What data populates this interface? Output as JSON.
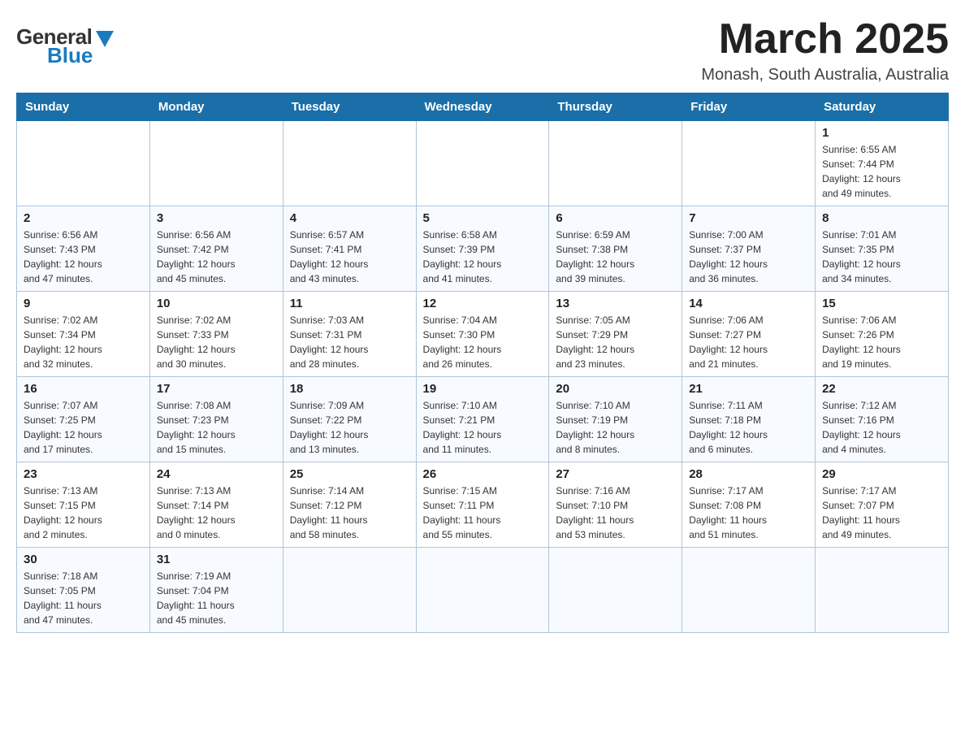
{
  "logo": {
    "general": "General",
    "blue": "Blue",
    "triangle": "▲"
  },
  "title": {
    "month": "March 2025",
    "location": "Monash, South Australia, Australia"
  },
  "weekdays": [
    "Sunday",
    "Monday",
    "Tuesday",
    "Wednesday",
    "Thursday",
    "Friday",
    "Saturday"
  ],
  "weeks": [
    [
      {
        "day": "",
        "info": ""
      },
      {
        "day": "",
        "info": ""
      },
      {
        "day": "",
        "info": ""
      },
      {
        "day": "",
        "info": ""
      },
      {
        "day": "",
        "info": ""
      },
      {
        "day": "",
        "info": ""
      },
      {
        "day": "1",
        "info": "Sunrise: 6:55 AM\nSunset: 7:44 PM\nDaylight: 12 hours\nand 49 minutes."
      }
    ],
    [
      {
        "day": "2",
        "info": "Sunrise: 6:56 AM\nSunset: 7:43 PM\nDaylight: 12 hours\nand 47 minutes."
      },
      {
        "day": "3",
        "info": "Sunrise: 6:56 AM\nSunset: 7:42 PM\nDaylight: 12 hours\nand 45 minutes."
      },
      {
        "day": "4",
        "info": "Sunrise: 6:57 AM\nSunset: 7:41 PM\nDaylight: 12 hours\nand 43 minutes."
      },
      {
        "day": "5",
        "info": "Sunrise: 6:58 AM\nSunset: 7:39 PM\nDaylight: 12 hours\nand 41 minutes."
      },
      {
        "day": "6",
        "info": "Sunrise: 6:59 AM\nSunset: 7:38 PM\nDaylight: 12 hours\nand 39 minutes."
      },
      {
        "day": "7",
        "info": "Sunrise: 7:00 AM\nSunset: 7:37 PM\nDaylight: 12 hours\nand 36 minutes."
      },
      {
        "day": "8",
        "info": "Sunrise: 7:01 AM\nSunset: 7:35 PM\nDaylight: 12 hours\nand 34 minutes."
      }
    ],
    [
      {
        "day": "9",
        "info": "Sunrise: 7:02 AM\nSunset: 7:34 PM\nDaylight: 12 hours\nand 32 minutes."
      },
      {
        "day": "10",
        "info": "Sunrise: 7:02 AM\nSunset: 7:33 PM\nDaylight: 12 hours\nand 30 minutes."
      },
      {
        "day": "11",
        "info": "Sunrise: 7:03 AM\nSunset: 7:31 PM\nDaylight: 12 hours\nand 28 minutes."
      },
      {
        "day": "12",
        "info": "Sunrise: 7:04 AM\nSunset: 7:30 PM\nDaylight: 12 hours\nand 26 minutes."
      },
      {
        "day": "13",
        "info": "Sunrise: 7:05 AM\nSunset: 7:29 PM\nDaylight: 12 hours\nand 23 minutes."
      },
      {
        "day": "14",
        "info": "Sunrise: 7:06 AM\nSunset: 7:27 PM\nDaylight: 12 hours\nand 21 minutes."
      },
      {
        "day": "15",
        "info": "Sunrise: 7:06 AM\nSunset: 7:26 PM\nDaylight: 12 hours\nand 19 minutes."
      }
    ],
    [
      {
        "day": "16",
        "info": "Sunrise: 7:07 AM\nSunset: 7:25 PM\nDaylight: 12 hours\nand 17 minutes."
      },
      {
        "day": "17",
        "info": "Sunrise: 7:08 AM\nSunset: 7:23 PM\nDaylight: 12 hours\nand 15 minutes."
      },
      {
        "day": "18",
        "info": "Sunrise: 7:09 AM\nSunset: 7:22 PM\nDaylight: 12 hours\nand 13 minutes."
      },
      {
        "day": "19",
        "info": "Sunrise: 7:10 AM\nSunset: 7:21 PM\nDaylight: 12 hours\nand 11 minutes."
      },
      {
        "day": "20",
        "info": "Sunrise: 7:10 AM\nSunset: 7:19 PM\nDaylight: 12 hours\nand 8 minutes."
      },
      {
        "day": "21",
        "info": "Sunrise: 7:11 AM\nSunset: 7:18 PM\nDaylight: 12 hours\nand 6 minutes."
      },
      {
        "day": "22",
        "info": "Sunrise: 7:12 AM\nSunset: 7:16 PM\nDaylight: 12 hours\nand 4 minutes."
      }
    ],
    [
      {
        "day": "23",
        "info": "Sunrise: 7:13 AM\nSunset: 7:15 PM\nDaylight: 12 hours\nand 2 minutes."
      },
      {
        "day": "24",
        "info": "Sunrise: 7:13 AM\nSunset: 7:14 PM\nDaylight: 12 hours\nand 0 minutes."
      },
      {
        "day": "25",
        "info": "Sunrise: 7:14 AM\nSunset: 7:12 PM\nDaylight: 11 hours\nand 58 minutes."
      },
      {
        "day": "26",
        "info": "Sunrise: 7:15 AM\nSunset: 7:11 PM\nDaylight: 11 hours\nand 55 minutes."
      },
      {
        "day": "27",
        "info": "Sunrise: 7:16 AM\nSunset: 7:10 PM\nDaylight: 11 hours\nand 53 minutes."
      },
      {
        "day": "28",
        "info": "Sunrise: 7:17 AM\nSunset: 7:08 PM\nDaylight: 11 hours\nand 51 minutes."
      },
      {
        "day": "29",
        "info": "Sunrise: 7:17 AM\nSunset: 7:07 PM\nDaylight: 11 hours\nand 49 minutes."
      }
    ],
    [
      {
        "day": "30",
        "info": "Sunrise: 7:18 AM\nSunset: 7:05 PM\nDaylight: 11 hours\nand 47 minutes."
      },
      {
        "day": "31",
        "info": "Sunrise: 7:19 AM\nSunset: 7:04 PM\nDaylight: 11 hours\nand 45 minutes."
      },
      {
        "day": "",
        "info": ""
      },
      {
        "day": "",
        "info": ""
      },
      {
        "day": "",
        "info": ""
      },
      {
        "day": "",
        "info": ""
      },
      {
        "day": "",
        "info": ""
      }
    ]
  ]
}
